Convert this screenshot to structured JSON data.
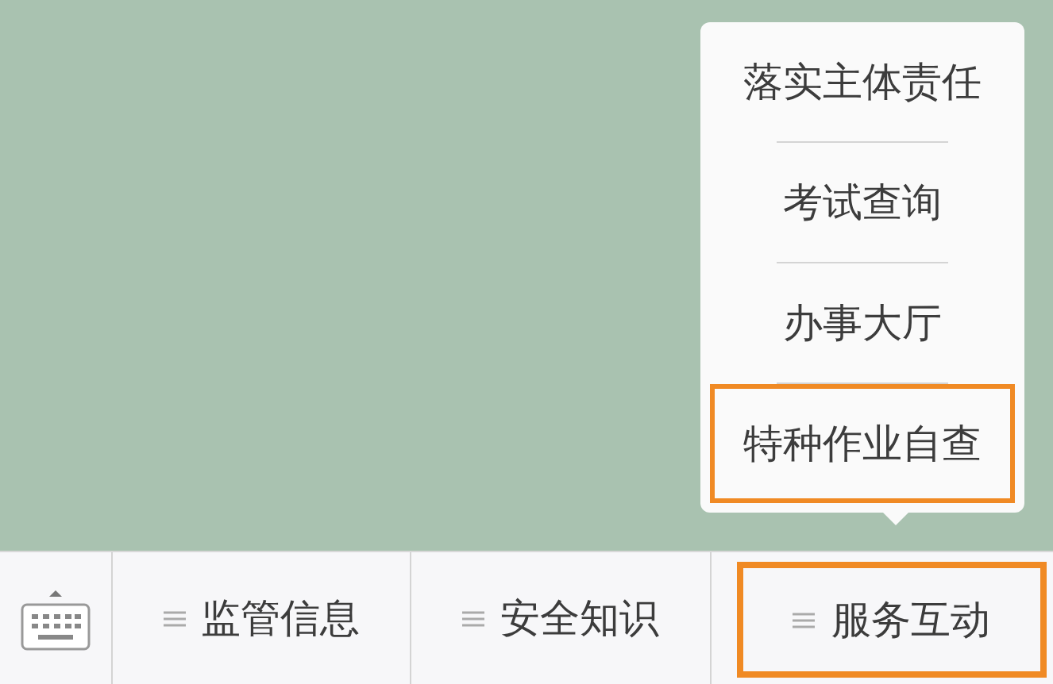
{
  "popup_menu": {
    "items": [
      {
        "label": "落实主体责任",
        "highlighted": false
      },
      {
        "label": "考试查询",
        "highlighted": false
      },
      {
        "label": "办事大厅",
        "highlighted": false
      },
      {
        "label": "特种作业自查",
        "highlighted": true
      }
    ]
  },
  "menu_bar": {
    "tabs": [
      {
        "label": "监管信息",
        "highlighted": false
      },
      {
        "label": "安全知识",
        "highlighted": false
      },
      {
        "label": "服务互动",
        "highlighted": true
      }
    ]
  }
}
